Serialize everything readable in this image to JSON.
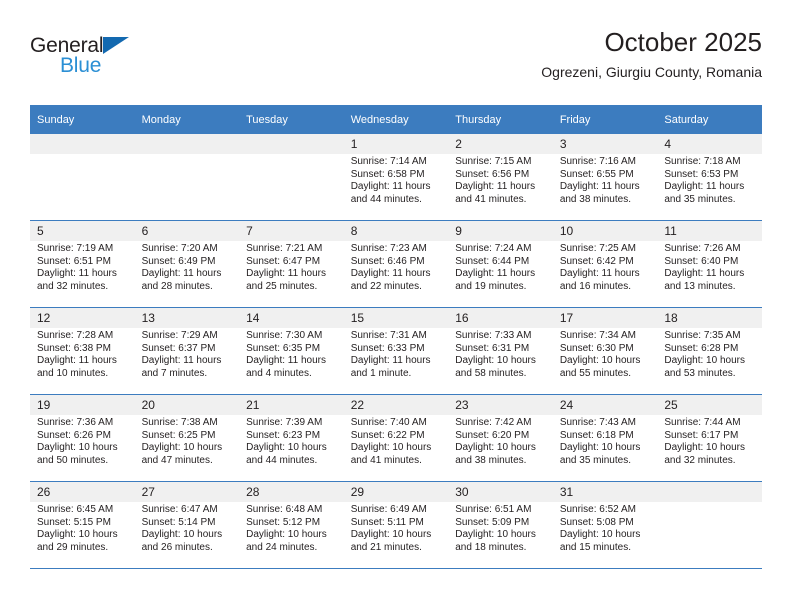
{
  "brand": {
    "name_top": "General",
    "name_bottom": "Blue",
    "triangle_color": "#1369b0",
    "blue_text_color": "#2b8fd4"
  },
  "header": {
    "title": "October 2025",
    "subtitle": "Ogrezeni, Giurgiu County, Romania"
  },
  "theme": {
    "header_bg": "#3c7cbf",
    "header_text": "#ffffff",
    "daynum_bg": "#f0f0f0",
    "cell_bg": "#ffffff",
    "text": "#231f20"
  },
  "calendar": {
    "weekday_headers": [
      "Sunday",
      "Monday",
      "Tuesday",
      "Wednesday",
      "Thursday",
      "Friday",
      "Saturday"
    ],
    "weeks": [
      [
        {
          "day": "",
          "sunrise": "",
          "sunset": "",
          "daylight": ""
        },
        {
          "day": "",
          "sunrise": "",
          "sunset": "",
          "daylight": ""
        },
        {
          "day": "",
          "sunrise": "",
          "sunset": "",
          "daylight": ""
        },
        {
          "day": "1",
          "sunrise": "Sunrise: 7:14 AM",
          "sunset": "Sunset: 6:58 PM",
          "daylight": "Daylight: 11 hours and 44 minutes."
        },
        {
          "day": "2",
          "sunrise": "Sunrise: 7:15 AM",
          "sunset": "Sunset: 6:56 PM",
          "daylight": "Daylight: 11 hours and 41 minutes."
        },
        {
          "day": "3",
          "sunrise": "Sunrise: 7:16 AM",
          "sunset": "Sunset: 6:55 PM",
          "daylight": "Daylight: 11 hours and 38 minutes."
        },
        {
          "day": "4",
          "sunrise": "Sunrise: 7:18 AM",
          "sunset": "Sunset: 6:53 PM",
          "daylight": "Daylight: 11 hours and 35 minutes."
        }
      ],
      [
        {
          "day": "5",
          "sunrise": "Sunrise: 7:19 AM",
          "sunset": "Sunset: 6:51 PM",
          "daylight": "Daylight: 11 hours and 32 minutes."
        },
        {
          "day": "6",
          "sunrise": "Sunrise: 7:20 AM",
          "sunset": "Sunset: 6:49 PM",
          "daylight": "Daylight: 11 hours and 28 minutes."
        },
        {
          "day": "7",
          "sunrise": "Sunrise: 7:21 AM",
          "sunset": "Sunset: 6:47 PM",
          "daylight": "Daylight: 11 hours and 25 minutes."
        },
        {
          "day": "8",
          "sunrise": "Sunrise: 7:23 AM",
          "sunset": "Sunset: 6:46 PM",
          "daylight": "Daylight: 11 hours and 22 minutes."
        },
        {
          "day": "9",
          "sunrise": "Sunrise: 7:24 AM",
          "sunset": "Sunset: 6:44 PM",
          "daylight": "Daylight: 11 hours and 19 minutes."
        },
        {
          "day": "10",
          "sunrise": "Sunrise: 7:25 AM",
          "sunset": "Sunset: 6:42 PM",
          "daylight": "Daylight: 11 hours and 16 minutes."
        },
        {
          "day": "11",
          "sunrise": "Sunrise: 7:26 AM",
          "sunset": "Sunset: 6:40 PM",
          "daylight": "Daylight: 11 hours and 13 minutes."
        }
      ],
      [
        {
          "day": "12",
          "sunrise": "Sunrise: 7:28 AM",
          "sunset": "Sunset: 6:38 PM",
          "daylight": "Daylight: 11 hours and 10 minutes."
        },
        {
          "day": "13",
          "sunrise": "Sunrise: 7:29 AM",
          "sunset": "Sunset: 6:37 PM",
          "daylight": "Daylight: 11 hours and 7 minutes."
        },
        {
          "day": "14",
          "sunrise": "Sunrise: 7:30 AM",
          "sunset": "Sunset: 6:35 PM",
          "daylight": "Daylight: 11 hours and 4 minutes."
        },
        {
          "day": "15",
          "sunrise": "Sunrise: 7:31 AM",
          "sunset": "Sunset: 6:33 PM",
          "daylight": "Daylight: 11 hours and 1 minute."
        },
        {
          "day": "16",
          "sunrise": "Sunrise: 7:33 AM",
          "sunset": "Sunset: 6:31 PM",
          "daylight": "Daylight: 10 hours and 58 minutes."
        },
        {
          "day": "17",
          "sunrise": "Sunrise: 7:34 AM",
          "sunset": "Sunset: 6:30 PM",
          "daylight": "Daylight: 10 hours and 55 minutes."
        },
        {
          "day": "18",
          "sunrise": "Sunrise: 7:35 AM",
          "sunset": "Sunset: 6:28 PM",
          "daylight": "Daylight: 10 hours and 53 minutes."
        }
      ],
      [
        {
          "day": "19",
          "sunrise": "Sunrise: 7:36 AM",
          "sunset": "Sunset: 6:26 PM",
          "daylight": "Daylight: 10 hours and 50 minutes."
        },
        {
          "day": "20",
          "sunrise": "Sunrise: 7:38 AM",
          "sunset": "Sunset: 6:25 PM",
          "daylight": "Daylight: 10 hours and 47 minutes."
        },
        {
          "day": "21",
          "sunrise": "Sunrise: 7:39 AM",
          "sunset": "Sunset: 6:23 PM",
          "daylight": "Daylight: 10 hours and 44 minutes."
        },
        {
          "day": "22",
          "sunrise": "Sunrise: 7:40 AM",
          "sunset": "Sunset: 6:22 PM",
          "daylight": "Daylight: 10 hours and 41 minutes."
        },
        {
          "day": "23",
          "sunrise": "Sunrise: 7:42 AM",
          "sunset": "Sunset: 6:20 PM",
          "daylight": "Daylight: 10 hours and 38 minutes."
        },
        {
          "day": "24",
          "sunrise": "Sunrise: 7:43 AM",
          "sunset": "Sunset: 6:18 PM",
          "daylight": "Daylight: 10 hours and 35 minutes."
        },
        {
          "day": "25",
          "sunrise": "Sunrise: 7:44 AM",
          "sunset": "Sunset: 6:17 PM",
          "daylight": "Daylight: 10 hours and 32 minutes."
        }
      ],
      [
        {
          "day": "26",
          "sunrise": "Sunrise: 6:45 AM",
          "sunset": "Sunset: 5:15 PM",
          "daylight": "Daylight: 10 hours and 29 minutes."
        },
        {
          "day": "27",
          "sunrise": "Sunrise: 6:47 AM",
          "sunset": "Sunset: 5:14 PM",
          "daylight": "Daylight: 10 hours and 26 minutes."
        },
        {
          "day": "28",
          "sunrise": "Sunrise: 6:48 AM",
          "sunset": "Sunset: 5:12 PM",
          "daylight": "Daylight: 10 hours and 24 minutes."
        },
        {
          "day": "29",
          "sunrise": "Sunrise: 6:49 AM",
          "sunset": "Sunset: 5:11 PM",
          "daylight": "Daylight: 10 hours and 21 minutes."
        },
        {
          "day": "30",
          "sunrise": "Sunrise: 6:51 AM",
          "sunset": "Sunset: 5:09 PM",
          "daylight": "Daylight: 10 hours and 18 minutes."
        },
        {
          "day": "31",
          "sunrise": "Sunrise: 6:52 AM",
          "sunset": "Sunset: 5:08 PM",
          "daylight": "Daylight: 10 hours and 15 minutes."
        },
        {
          "day": "",
          "sunrise": "",
          "sunset": "",
          "daylight": ""
        }
      ]
    ]
  }
}
